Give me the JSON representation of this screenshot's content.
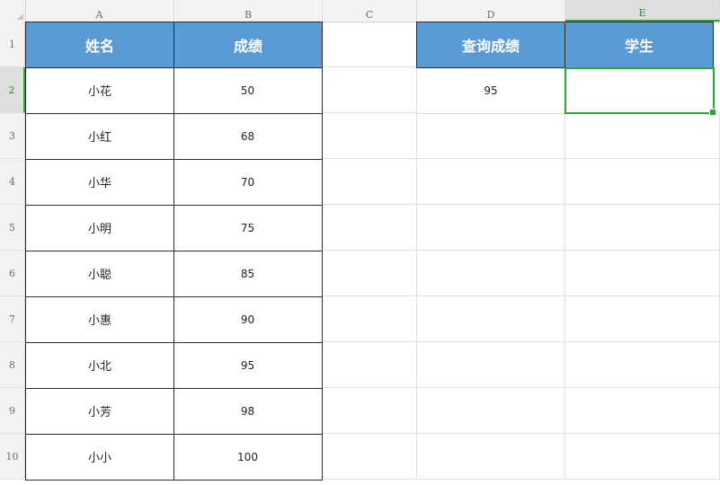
{
  "columns": [
    "A",
    "B",
    "C",
    "D",
    "E"
  ],
  "rows": [
    "1",
    "2",
    "3",
    "4",
    "5",
    "6",
    "7",
    "8",
    "9",
    "10"
  ],
  "active_cell": "E2",
  "headers": {
    "A": "姓名",
    "B": "成绩",
    "D": "查询成绩",
    "E": "学生"
  },
  "students": [
    {
      "name": "小花",
      "score": "50"
    },
    {
      "name": "小红",
      "score": "68"
    },
    {
      "name": "小华",
      "score": "70"
    },
    {
      "name": "小明",
      "score": "75"
    },
    {
      "name": "小聪",
      "score": "85"
    },
    {
      "name": "小惠",
      "score": "90"
    },
    {
      "name": "小北",
      "score": "95"
    },
    {
      "name": "小芳",
      "score": "98"
    },
    {
      "name": "小小",
      "score": "100"
    }
  ],
  "query": {
    "score": "95",
    "student": ""
  },
  "colors": {
    "header_fill": "#5b9bd5",
    "selection": "#2fa23a"
  }
}
